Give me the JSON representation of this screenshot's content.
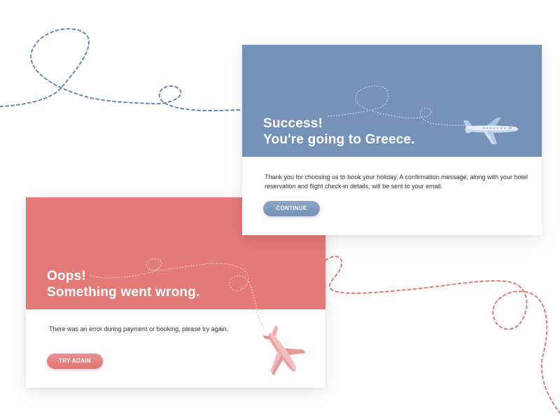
{
  "success_card": {
    "title_line1": "Success!",
    "title_line2": "You're going to Greece.",
    "message": "Thank you for choosing us to book your holiday. A confirmation message, along with your hotel reservation and flight check-in  details, will be sent to your email.",
    "button_label": "CONTINUE",
    "header_color": "#7592b8",
    "icon": "airplane-icon"
  },
  "error_card": {
    "title_line1": "Oops!",
    "title_line2": "Something went wrong.",
    "message": "There was an error during payment or booking, please try again.",
    "button_label": "TRY AGAIN",
    "header_color": "#e37a77",
    "icon": "falling-airplane-icon"
  },
  "colors": {
    "blue_dash": "#6b87b3",
    "red_dash": "#e37a77",
    "background": "#ffffff"
  }
}
